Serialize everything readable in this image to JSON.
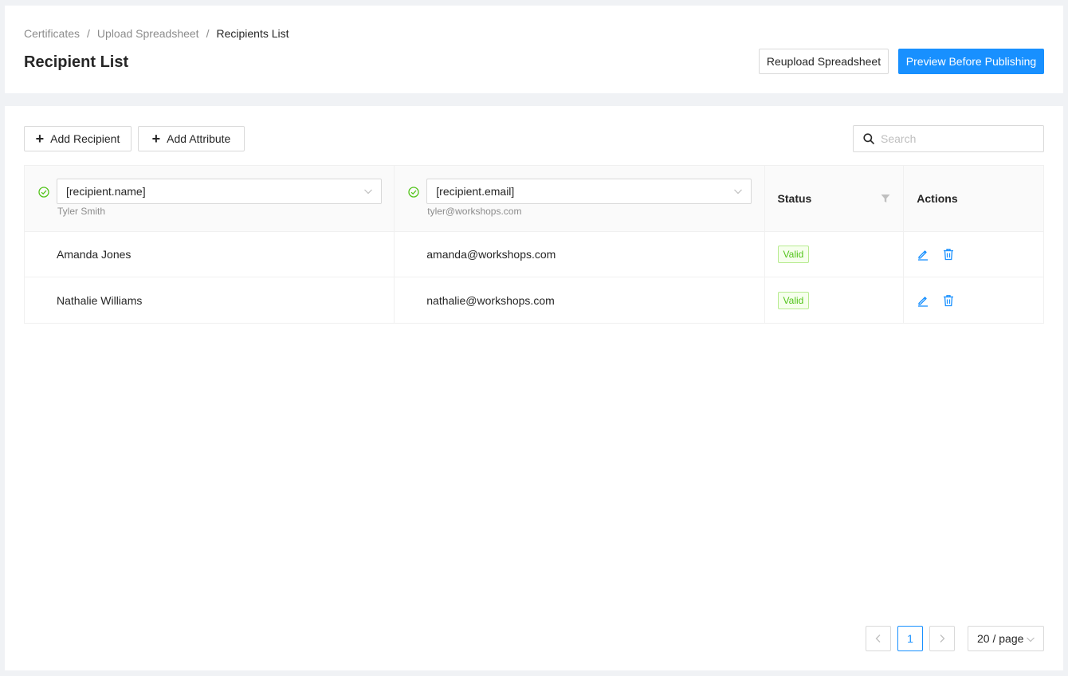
{
  "breadcrumb": [
    "Certificates",
    "Upload Spreadsheet",
    "Recipients List"
  ],
  "breadcrumb_separator": "/",
  "page_title": "Recipient List",
  "header_buttons": {
    "reupload": "Reupload Spreadsheet",
    "preview": "Preview Before Publishing"
  },
  "toolbar": {
    "add_recipient": "Add Recipient",
    "add_attribute": "Add Attribute",
    "search_placeholder": "Search"
  },
  "table": {
    "columns": [
      {
        "value": "[recipient.name]",
        "sample": "Tyler Smith"
      },
      {
        "value": "[recipient.email]",
        "sample": "tyler@workshops.com"
      }
    ],
    "status_header": "Status",
    "actions_header": "Actions",
    "rows": [
      {
        "name": "Amanda Jones",
        "email": "amanda@workshops.com",
        "status": "Valid"
      },
      {
        "name": "Nathalie Williams",
        "email": "nathalie@workshops.com",
        "status": "Valid"
      }
    ]
  },
  "pagination": {
    "current_page": "1",
    "page_size": "20 / page"
  },
  "colors": {
    "primary": "#1890ff",
    "success": "#52c41a",
    "border": "#d9d9d9"
  }
}
